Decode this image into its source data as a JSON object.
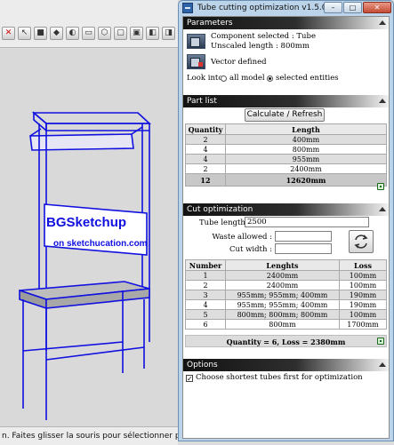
{
  "toolbar": {
    "icons": [
      "close-icon",
      "select-icon",
      "box-icon",
      "component-icon",
      "paint-icon",
      "eraser-icon",
      "iso-view-icon",
      "top-view-icon",
      "front-view-icon",
      "right-view-icon",
      "back-view-icon",
      "left-view-icon"
    ]
  },
  "model": {
    "logo_text": "BGSketchup",
    "logo_sub": "on sketchucation.com",
    "color": "#1010e0"
  },
  "status_bar": {
    "text": "n. Faites glisser la souris pour sélectionner plusi"
  },
  "dialog": {
    "title": "Tube cutting optimization v1.5.0",
    "window_buttons": {
      "minimize": "–",
      "maximize": "□",
      "close": "✕"
    },
    "parameters": {
      "header": "Parameters",
      "component_line": "Component selected : Tube",
      "length_line": "Unscaled length : 800mm",
      "vector_line": "Vector defined",
      "look_into_label": "Look into",
      "option_all": "all model",
      "option_selected": "selected entities",
      "selected_option": "selected entities"
    },
    "part_list": {
      "header": "Part list",
      "calculate_button": "Calculate / Refresh",
      "columns": [
        "Quantity",
        "Length"
      ],
      "rows": [
        {
          "quantity": "2",
          "length": "400mm"
        },
        {
          "quantity": "4",
          "length": "800mm"
        },
        {
          "quantity": "4",
          "length": "955mm"
        },
        {
          "quantity": "2",
          "length": "2400mm"
        }
      ],
      "total_quantity": "12",
      "total_length": "12620mm"
    },
    "cut_optimization": {
      "header": "Cut optimization",
      "tube_length_label": "Tube length :",
      "tube_length_value": "2500",
      "waste_label": "Waste allowed :",
      "waste_value": "",
      "cut_width_label": "Cut width :",
      "cut_width_value": "",
      "columns": [
        "Number",
        "Lenghts",
        "Loss"
      ],
      "rows": [
        {
          "number": "1",
          "lengths": "2400mm",
          "loss": "100mm"
        },
        {
          "number": "2",
          "lengths": "2400mm",
          "loss": "100mm"
        },
        {
          "number": "3",
          "lengths": "955mm; 955mm; 400mm",
          "loss": "190mm"
        },
        {
          "number": "4",
          "lengths": "955mm; 955mm; 400mm",
          "loss": "190mm"
        },
        {
          "number": "5",
          "lengths": "800mm; 800mm; 800mm",
          "loss": "100mm"
        },
        {
          "number": "6",
          "lengths": "800mm",
          "loss": "1700mm"
        }
      ],
      "summary": "Quantity = 6, Loss = 2380mm"
    },
    "options": {
      "header": "Options",
      "shortest_first_label": "Choose shortest tubes first for optimization",
      "shortest_first_checked": true,
      "check_mark": "✓"
    }
  },
  "colors": {
    "dialog_frame": "#bcd4e9",
    "header_dark": "#121212",
    "model_blue": "#1010e0"
  }
}
